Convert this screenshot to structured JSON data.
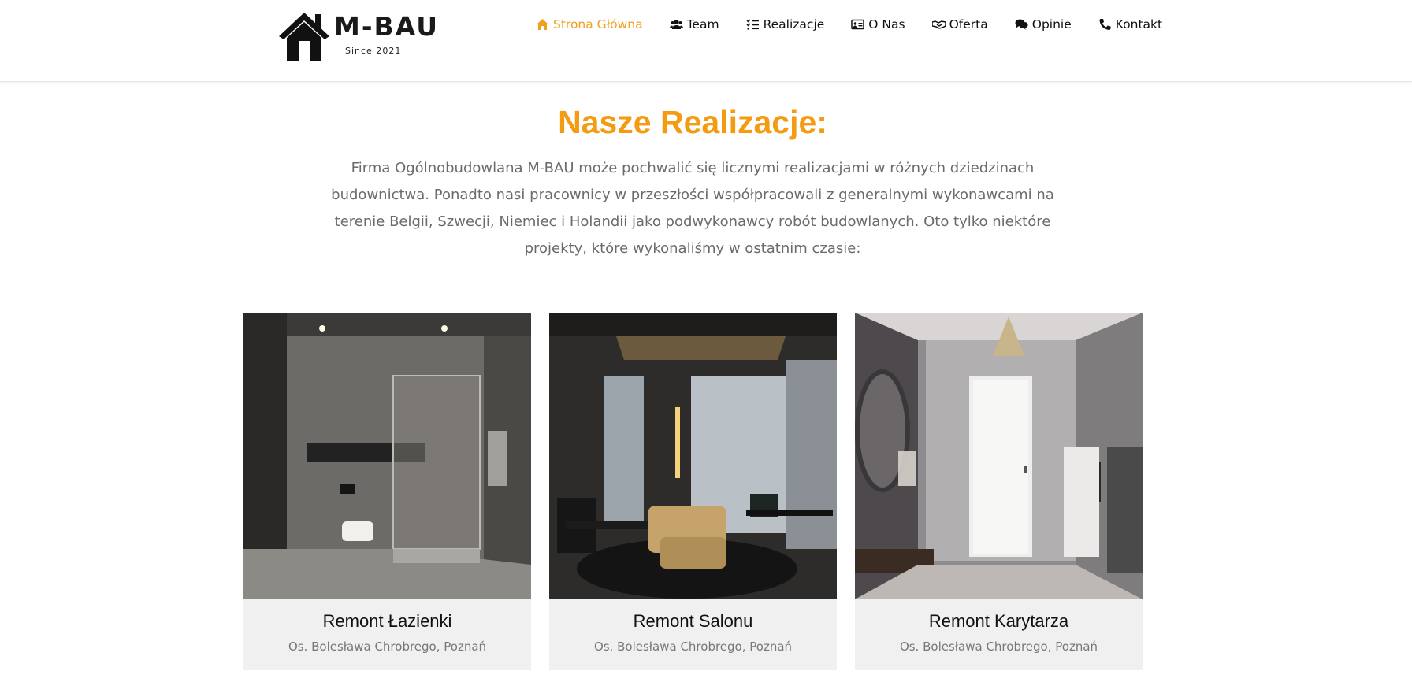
{
  "brand": {
    "name": "M-BAU",
    "tagline": "Since 2021"
  },
  "nav": {
    "items": [
      {
        "label": "Strona Główna",
        "icon": "home-icon",
        "active": true
      },
      {
        "label": "Team",
        "icon": "users-icon",
        "active": false
      },
      {
        "label": "Realizacje",
        "icon": "list-icon",
        "active": false
      },
      {
        "label": "O Nas",
        "icon": "id-card-icon",
        "active": false
      },
      {
        "label": "Oferta",
        "icon": "handshake-icon",
        "active": false
      },
      {
        "label": "Opinie",
        "icon": "comments-icon",
        "active": false
      },
      {
        "label": "Kontakt",
        "icon": "phone-icon",
        "active": false
      }
    ],
    "active_color": "#f0a01b"
  },
  "section": {
    "title": "Nasze Realizacje:",
    "intro": "Firma Ogólnobudowlana M-BAU może pochwalić się licznymi realizacjami w różnych dziedzinach budownictwa. Ponadto nasi pracownicy w przeszłości współpracowali z generalnymi wykonawcami na terenie Belgii, Szwecji, Niemiec i Holandii jako podwykonawcy robót budowlanych. Oto tylko niektóre projekty, które wykonaliśmy w ostatnim czasie:",
    "title_color": "#f39c12"
  },
  "projects": [
    {
      "title": "Remont Łazienki",
      "location": "Os. Bolesława Chrobrego, Poznań",
      "image": "bathroom-photo"
    },
    {
      "title": "Remont Salonu",
      "location": "Os. Bolesława Chrobrego, Poznań",
      "image": "living-room-photo"
    },
    {
      "title": "Remont Karytarza",
      "location": "Os. Bolesława Chrobrego, Poznań",
      "image": "hallway-photo"
    }
  ]
}
